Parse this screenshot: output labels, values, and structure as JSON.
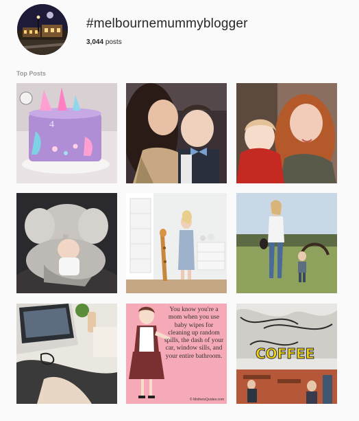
{
  "header": {
    "hashtag": "#melbournemummyblogger",
    "posts_count": "3,044",
    "posts_label": "posts"
  },
  "section": {
    "title": "Top Posts"
  },
  "posts": [
    {
      "subject": "mermaid-cake"
    },
    {
      "subject": "mother-son-selfie"
    },
    {
      "subject": "redhead-mother-child"
    },
    {
      "subject": "baby-with-elephant"
    },
    {
      "subject": "nursery-giraffe"
    },
    {
      "subject": "walk-outdoors"
    },
    {
      "subject": "laptop-desk"
    },
    {
      "subject": "mom-quote",
      "quote": "You know you're a mom when you use baby wipes for cleaning up random spills, the dash of your car, window sills, and your entire bathroom.",
      "credit": "© MothersQuotes.com"
    },
    {
      "subject": "coffee-mural-cafe",
      "mural_text": "COFFEE"
    }
  ]
}
